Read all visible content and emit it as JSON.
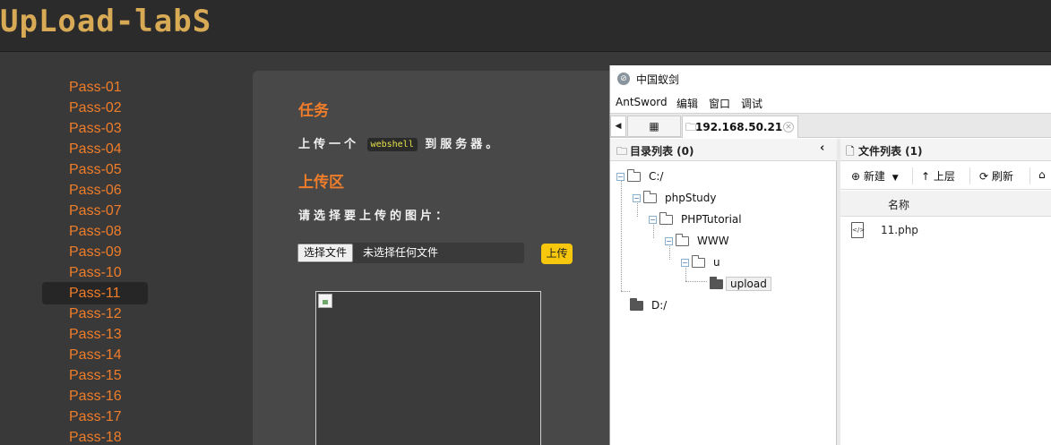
{
  "app": {
    "logo": "UpLoad-labS"
  },
  "sidebar": {
    "items": [
      "Pass-01",
      "Pass-02",
      "Pass-03",
      "Pass-04",
      "Pass-05",
      "Pass-06",
      "Pass-07",
      "Pass-08",
      "Pass-09",
      "Pass-10",
      "Pass-11",
      "Pass-12",
      "Pass-13",
      "Pass-14",
      "Pass-15",
      "Pass-16",
      "Pass-17",
      "Pass-18"
    ],
    "active": "Pass-11"
  },
  "content": {
    "task_title": "任务",
    "task_before": "上传一个",
    "task_code": "webshell",
    "task_after": "到服务器。",
    "upload_title": "上传区",
    "upload_prompt": "请选择要上传的图片：",
    "choose_file_label": "选择文件",
    "no_file_label": "未选择任何文件",
    "upload_button": "上传"
  },
  "antsword": {
    "title": "中国蚁剑",
    "menu": [
      "AntSword",
      "编辑",
      "窗口",
      "调试"
    ],
    "tab_host": "192.168.50.21",
    "dir_panel_title": "目录列表 (0)",
    "file_panel_title": "文件列表 (1)",
    "tree": {
      "c_drive": "C:/",
      "phpstudy": "phpStudy",
      "phptutorial": "PHPTutorial",
      "www": "WWW",
      "u": "u",
      "upload": "upload",
      "d_drive": "D:/"
    },
    "toolbar": {
      "new": "新建",
      "up": "上层",
      "refresh": "刷新"
    },
    "column_name": "名称",
    "files": [
      "11.php"
    ]
  },
  "colors": {
    "accent_orange": "#f07d2a",
    "logo_gold": "#d8aa55",
    "upload_yellow": "#f6c70c"
  }
}
